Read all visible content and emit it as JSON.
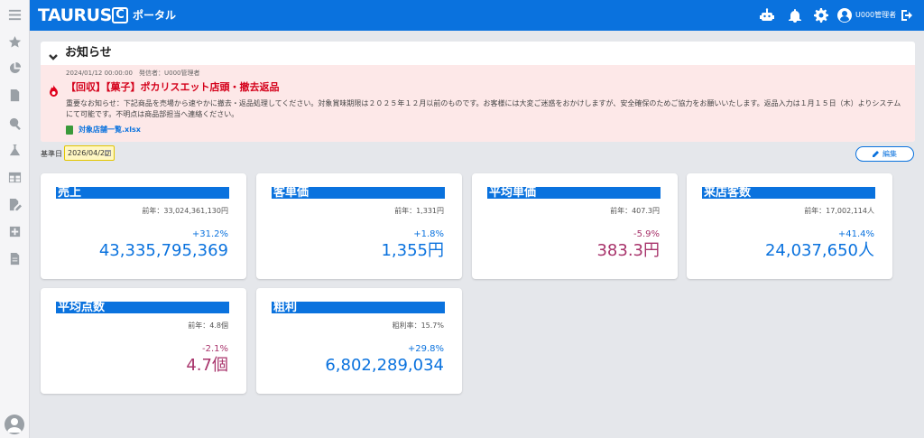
{
  "header": {
    "brand": "TAURUS",
    "brand_mark": "C",
    "portal": "ポータル",
    "user": "U000管理者"
  },
  "notice": {
    "title": "お知らせ",
    "meta": "2024/01/12 00:00:00　発信者：U000管理者",
    "headline": "【回収】【菓子】ポカリスエット店頭・撤去返品",
    "text": "重要なお知らせ：下記商品を売場から速やかに撤去・返品処理してください。対象賞味期限は２０２５年１２月以前のものです。お客様には大変ご迷惑をおかけしますが、安全確保のためご協力をお願いいたします。返品入力は１月１５日（木）よりシステムにて可能です。不明点は商品部担当へ連絡ください。",
    "file": "対象店舗一覧.xlsx"
  },
  "filters": {
    "date_label": "基準日",
    "date_value": "2026/04/20",
    "edit_label": "編集"
  },
  "cards": [
    {
      "title": "売上",
      "prev": "前年：33,024,361,130円",
      "change": "+31.2%",
      "trend": "up",
      "value": "43,335,795,369"
    },
    {
      "title": "客単価",
      "prev": "前年：1,331円",
      "change": "+1.8%",
      "trend": "up",
      "value": "1,355円"
    },
    {
      "title": "平均単価",
      "prev": "前年：407.3円",
      "change": "-5.9%",
      "trend": "down",
      "value": "383.3円"
    },
    {
      "title": "来店客数",
      "prev": "前年：17,002,114人",
      "change": "+41.4%",
      "trend": "up",
      "value": "24,037,650人"
    },
    {
      "title": "平均点数",
      "prev": "前年：4.8個",
      "change": "-2.1%",
      "trend": "down",
      "value": "4.7個"
    },
    {
      "title": "粗利",
      "prev": "粗利率：15.7%",
      "change": "+29.8%",
      "trend": "up",
      "value": "6,802,289,034"
    }
  ],
  "icons": {
    "sidebar": [
      "menu-icon",
      "star-icon",
      "pie-chart-icon",
      "document-icon",
      "search-chart-icon",
      "flask-icon",
      "table-icon",
      "edit-document-icon",
      "plus-box-icon",
      "file-icon"
    ],
    "topbar": [
      "robot-icon",
      "bell-icon",
      "gear-icon",
      "user-circle-icon",
      "logout-icon"
    ]
  },
  "colors": {
    "primary": "#0a72de",
    "up": "#0a72de",
    "down": "#a8336b",
    "notice_bg": "#fde8e8",
    "alert": "#d4001a"
  }
}
